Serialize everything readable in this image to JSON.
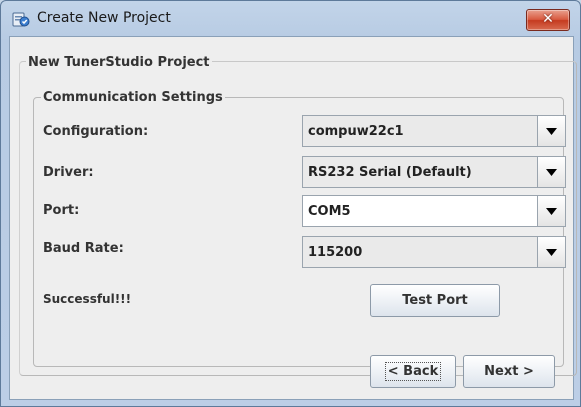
{
  "window": {
    "title": "Create New Project"
  },
  "icons": {
    "app": "project-wizard-icon",
    "close": "close-x-icon",
    "dropdown": "triangle-down-icon"
  },
  "colors": {
    "close_button": "#d24a2e",
    "title_gradient_top": "#c2d4e9",
    "client_bg": "#eeeeee"
  },
  "project_group": {
    "title": "New TunerStudio Project"
  },
  "comm_group": {
    "title": "Communication Settings",
    "fields": {
      "configuration": {
        "label": "Configuration:",
        "value": "compuw22c1"
      },
      "driver": {
        "label": "Driver:",
        "value": "RS232 Serial (Default)"
      },
      "port": {
        "label": "Port:",
        "value": "COM5"
      },
      "baud": {
        "label": "Baud Rate:",
        "value": "115200"
      }
    },
    "status": "Successful!!!",
    "test_port_label": "Test Port"
  },
  "nav": {
    "back_label": "< Back",
    "next_label": "Next >"
  }
}
